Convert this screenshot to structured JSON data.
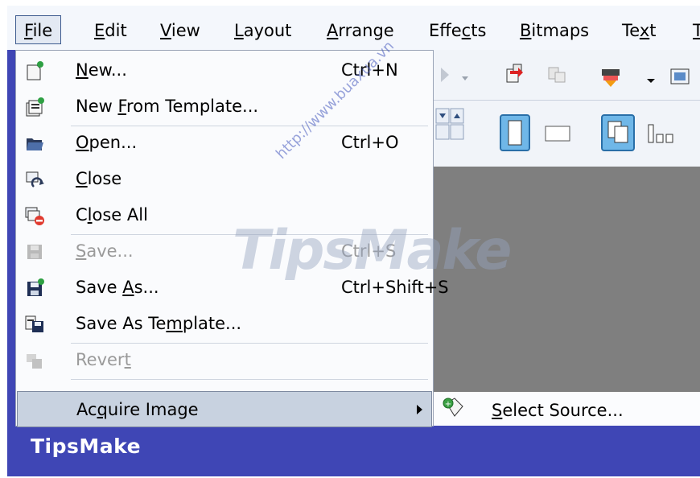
{
  "menubar": {
    "items": [
      {
        "label": "File",
        "mnemonic_index": 0,
        "active": true
      },
      {
        "label": "Edit",
        "mnemonic_index": 0
      },
      {
        "label": "View",
        "mnemonic_index": 0
      },
      {
        "label": "Layout",
        "mnemonic_index": 0
      },
      {
        "label": "Arrange",
        "mnemonic_index": 0
      },
      {
        "label": "Effects",
        "mnemonic_index": 4
      },
      {
        "label": "Bitmaps",
        "mnemonic_index": 0
      },
      {
        "label": "Text",
        "mnemonic_index": 2
      },
      {
        "label": "T",
        "mnemonic_index": 0
      }
    ]
  },
  "file_menu": {
    "items": [
      {
        "label": "New...",
        "shortcut": "Ctrl+N",
        "icon": "new-document-icon",
        "enabled": true
      },
      {
        "label": "New From Template...",
        "shortcut": "",
        "icon": "new-from-template-icon",
        "enabled": true
      },
      {
        "label": "Open...",
        "shortcut": "Ctrl+O",
        "icon": "folder-open-icon",
        "enabled": true
      },
      {
        "label": "Close",
        "shortcut": "",
        "icon": "close-document-icon",
        "enabled": true
      },
      {
        "label": "Close All",
        "shortcut": "",
        "icon": "close-all-icon",
        "enabled": true
      },
      {
        "label": "Save...",
        "shortcut": "Ctrl+S",
        "icon": "save-icon",
        "enabled": false
      },
      {
        "label": "Save As...",
        "shortcut": "Ctrl+Shift+S",
        "icon": "save-as-icon",
        "enabled": true
      },
      {
        "label": "Save As Template...",
        "shortcut": "",
        "icon": "save-as-template-icon",
        "enabled": true
      },
      {
        "label": "Revert",
        "shortcut": "",
        "icon": "revert-icon",
        "enabled": false
      },
      {
        "label": "Acquire Image",
        "shortcut": "",
        "icon": "",
        "enabled": true,
        "submenu": true
      }
    ]
  },
  "submenu": {
    "items": [
      {
        "label": "Select Source...",
        "icon": "select-source-icon"
      }
    ]
  },
  "watermark": {
    "text": "TipsMake",
    "url_text": "http://www.buaxua.vn"
  },
  "footer": {
    "brand": "TipsMake"
  },
  "colors": {
    "frame": "#3f46b5",
    "menubar": "#f4f7fc",
    "canvas": "#7f7f7f",
    "highlight": "#c8d2e0"
  }
}
